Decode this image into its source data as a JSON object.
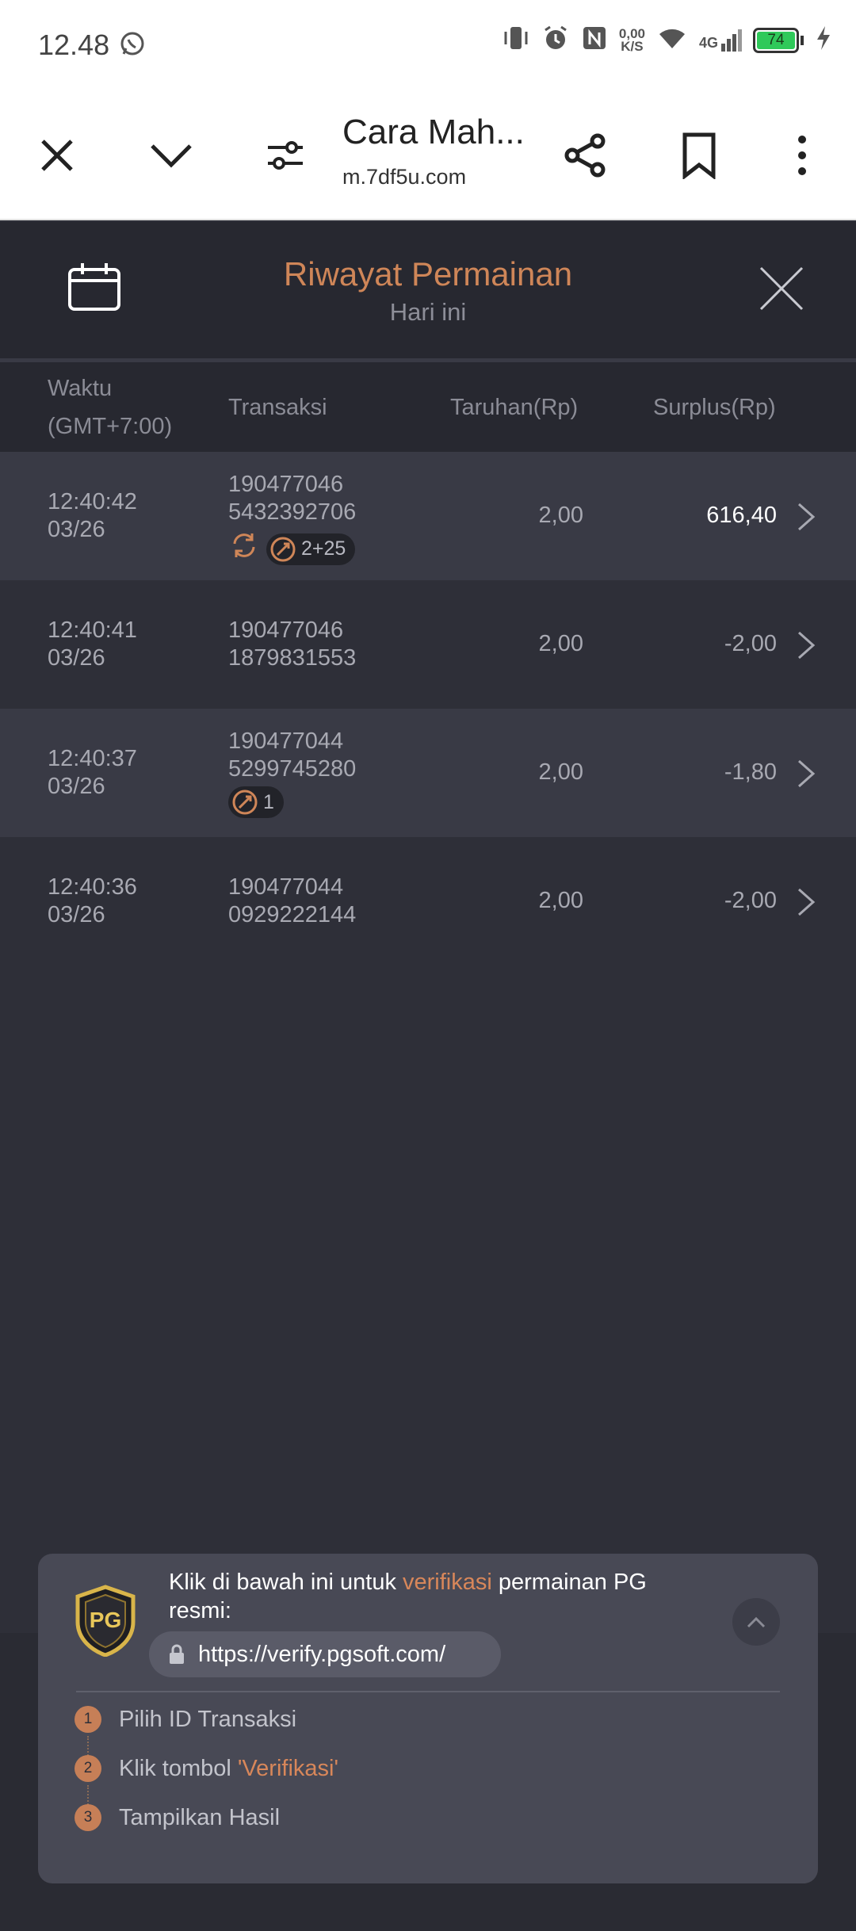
{
  "status_bar": {
    "time": "12.48",
    "net_speed_value": "0,00",
    "net_speed_unit": "K/S",
    "network": "4G",
    "battery": "74"
  },
  "browser": {
    "title": "Cara Mah...",
    "url": "m.7df5u.com"
  },
  "panel": {
    "title": "Riwayat Permainan",
    "subtitle": "Hari ini"
  },
  "table": {
    "headers": {
      "time": "Waktu",
      "timezone": "(GMT+7:00)",
      "transaction": "Transaksi",
      "bet": "Taruhan(Rp)",
      "surplus": "Surplus(Rp)"
    },
    "rows": [
      {
        "time": "12:40:42",
        "date": "03/26",
        "tx1": "190477046",
        "tx2": "5432392706",
        "badge": "2+25",
        "bet": "2,00",
        "surplus": "616,40"
      },
      {
        "time": "12:40:41",
        "date": "03/26",
        "tx1": "190477046",
        "tx2": "1879831553",
        "badge": "",
        "bet": "2,00",
        "surplus": "-2,00"
      },
      {
        "time": "12:40:37",
        "date": "03/26",
        "tx1": "190477044",
        "tx2": "5299745280",
        "badge": "1",
        "bet": "2,00",
        "surplus": "-1,80"
      },
      {
        "time": "12:40:36",
        "date": "03/26",
        "tx1": "190477044",
        "tx2": "0929222144",
        "badge": "",
        "bet": "2,00",
        "surplus": "-2,00"
      }
    ]
  },
  "verify": {
    "logo_text": "PG",
    "text_before": "Klik di bawah ini untuk ",
    "text_highlight": "verifikasi",
    "text_after": " permainan PG resmi:",
    "url": "https://verify.pgsoft.com/",
    "steps": [
      {
        "num": "1",
        "text": "Pilih ID Transaksi",
        "highlight": ""
      },
      {
        "num": "2",
        "text": "Klik tombol ",
        "highlight": "'Verifikasi'"
      },
      {
        "num": "3",
        "text": "Tampilkan Hasil",
        "highlight": ""
      }
    ]
  },
  "colors": {
    "accent": "#cf8658",
    "panel_bg": "#2e2f38",
    "row_alt_bg": "#393a45",
    "header_bg": "#272830"
  }
}
